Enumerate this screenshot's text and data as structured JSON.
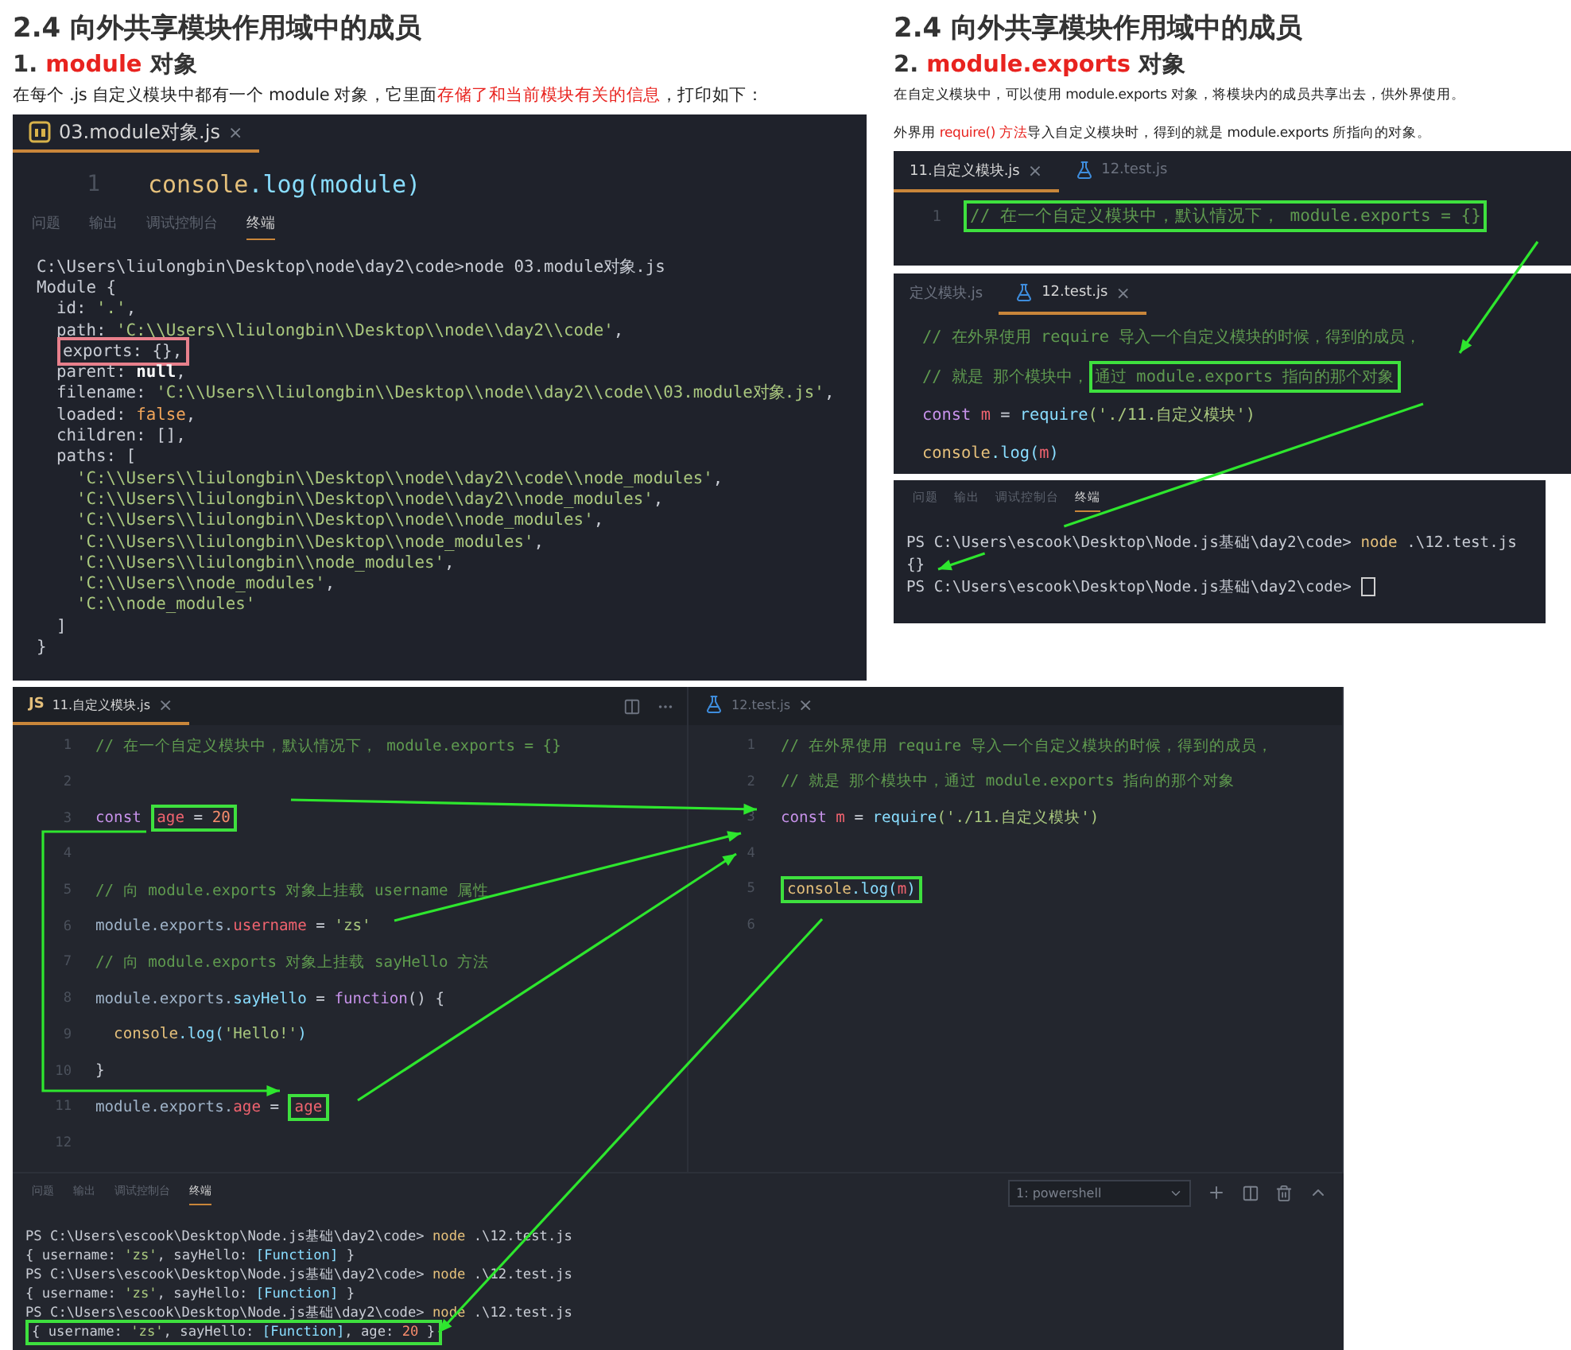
{
  "left_slide": {
    "title": "2.4 向外共享模块作用域中的成员",
    "heading": {
      "number": "1.",
      "keyword": "module",
      "suffix": "对象"
    },
    "description": [
      {
        "text": "在每个 .js 自定义模块中都有一个 module 对象，它里面",
        "emphasis": false
      },
      {
        "text": "存储了和当前模块有关的信息",
        "emphasis": true
      },
      {
        "text": "，打印如下：",
        "emphasis": false
      }
    ],
    "editor": {
      "tabs": [
        {
          "label": "03.module对象.js",
          "kind": "script",
          "close": "×",
          "selected": true
        }
      ],
      "lines": [
        {
          "number": "1",
          "tokens": [
            {
              "kind": "function",
              "text": "console"
            },
            {
              "kind": "method",
              "text": ".log(module)"
            }
          ]
        }
      ]
    },
    "panel_tabs": [
      {
        "label": "问题",
        "selected": false
      },
      {
        "label": "输出",
        "selected": false
      },
      {
        "label": "调试控制台",
        "selected": false
      },
      {
        "label": "终端",
        "selected": true
      }
    ],
    "terminal": [
      {
        "tokens": [
          {
            "kind": "text",
            "text": "C:\\Users\\liulongbin\\Desktop\\node\\day2\\code>node 03.module对象.js"
          }
        ]
      },
      {
        "tokens": [
          {
            "kind": "text",
            "text": "Module {"
          }
        ]
      },
      {
        "tokens": [
          {
            "kind": "text",
            "text": "  id: "
          },
          {
            "kind": "string",
            "text": "'.'"
          },
          {
            "kind": "text",
            "text": ","
          }
        ]
      },
      {
        "tokens": [
          {
            "kind": "text",
            "text": "  path: "
          },
          {
            "kind": "string",
            "text": "'C:\\\\Users\\\\liulongbin\\\\Desktop\\\\node\\\\day2\\\\code'"
          },
          {
            "kind": "text",
            "text": ","
          }
        ]
      },
      {
        "tokens": [
          {
            "kind": "frame",
            "tokens": [
              {
                "kind": "text",
                "text": "exports: {},"
              }
            ]
          }
        ]
      },
      {
        "tokens": [
          {
            "kind": "text",
            "text": "  parent: "
          },
          {
            "kind": "null",
            "text": "null"
          },
          {
            "kind": "text",
            "text": ","
          }
        ]
      },
      {
        "tokens": [
          {
            "kind": "text",
            "text": "  filename: "
          },
          {
            "kind": "string",
            "text": "'C:\\\\Users\\\\liulongbin\\\\Desktop\\\\node\\\\day2\\\\code\\\\03.module对象.js'"
          },
          {
            "kind": "text",
            "text": ","
          }
        ]
      },
      {
        "tokens": [
          {
            "kind": "text",
            "text": "  loaded: "
          },
          {
            "kind": "boolean",
            "text": "false"
          },
          {
            "kind": "text",
            "text": ","
          }
        ]
      },
      {
        "tokens": [
          {
            "kind": "text",
            "text": "  children: [],"
          }
        ]
      },
      {
        "tokens": [
          {
            "kind": "text",
            "text": "  paths: ["
          }
        ]
      },
      {
        "tokens": [
          {
            "kind": "string",
            "text": "    'C:\\\\Users\\\\liulongbin\\\\Desktop\\\\node\\\\day2\\\\code\\\\node_modules'"
          },
          {
            "kind": "text",
            "text": ","
          }
        ]
      },
      {
        "tokens": [
          {
            "kind": "string",
            "text": "    'C:\\\\Users\\\\liulongbin\\\\Desktop\\\\node\\\\day2\\\\node_modules'"
          },
          {
            "kind": "text",
            "text": ","
          }
        ]
      },
      {
        "tokens": [
          {
            "kind": "string",
            "text": "    'C:\\\\Users\\\\liulongbin\\\\Desktop\\\\node\\\\node_modules'"
          },
          {
            "kind": "text",
            "text": ","
          }
        ]
      },
      {
        "tokens": [
          {
            "kind": "string",
            "text": "    'C:\\\\Users\\\\liulongbin\\\\Desktop\\\\node_modules'"
          },
          {
            "kind": "text",
            "text": ","
          }
        ]
      },
      {
        "tokens": [
          {
            "kind": "string",
            "text": "    'C:\\\\Users\\\\liulongbin\\\\node_modules'"
          },
          {
            "kind": "text",
            "text": ","
          }
        ]
      },
      {
        "tokens": [
          {
            "kind": "string",
            "text": "    'C:\\\\Users\\\\node_modules'"
          },
          {
            "kind": "text",
            "text": ","
          }
        ]
      },
      {
        "tokens": [
          {
            "kind": "string",
            "text": "    'C:\\\\node_modules'"
          }
        ]
      },
      {
        "tokens": [
          {
            "kind": "text",
            "text": "  ]"
          }
        ]
      },
      {
        "tokens": [
          {
            "kind": "text",
            "text": "}"
          }
        ]
      }
    ]
  },
  "right_slide": {
    "title": "2.4 向外共享模块作用域中的成员",
    "heading": {
      "number": "2.",
      "keyword": "module.exports",
      "suffix": "对象"
    },
    "description": [
      {
        "text": "在自定义模块中，可以使用 module.exports 对象，将模块内的成员共享出去，供外界使用。",
        "emphasis": false
      }
    ],
    "note": [
      {
        "text": "外界用 ",
        "emphasis": false
      },
      {
        "text": "require() 方法",
        "emphasis": true
      },
      {
        "text": "导入自定义模块时，得到的就是 module.exports 所指向的对象。",
        "emphasis": false
      }
    ],
    "module_editor": {
      "tabs": [
        {
          "label": "11.自定义模块.js",
          "close": "×",
          "selected": true
        },
        {
          "label": "12.test.js",
          "kind": "test",
          "selected": false
        }
      ],
      "lines": [
        {
          "number": "1",
          "tokens": [
            {
              "kind": "box",
              "tokens": [
                {
                  "kind": "comment",
                  "text": "// 在一个自定义模块中，默认情况下， module.exports = {}"
                }
              ]
            }
          ]
        }
      ]
    },
    "test_editor": {
      "tabs": [
        {
          "label": "定义模块.js",
          "selected": false
        },
        {
          "label": "12.test.js",
          "kind": "test",
          "close": "×",
          "selected": true
        }
      ],
      "lines": [
        {
          "tokens": [
            {
              "kind": "comment",
              "text": "// 在外界使用 require 导入一个自定义模块的时候，得到的成员，"
            }
          ]
        },
        {
          "tokens": [
            {
              "kind": "comment",
              "text": "// 就是 那个模块中，"
            },
            {
              "kind": "box",
              "tokens": [
                {
                  "kind": "comment",
                  "text": "通过 module.exports 指向的那个对象"
                }
              ]
            }
          ]
        },
        {
          "tokens": [
            {
              "kind": "keyword",
              "text": "const "
            },
            {
              "kind": "variable",
              "text": "m"
            },
            {
              "kind": "text",
              "text": " = "
            },
            {
              "kind": "method",
              "text": "require"
            },
            {
              "kind": "string",
              "text": "('./11.自定义模块')"
            }
          ]
        },
        {
          "tokens": [
            {
              "kind": "function",
              "text": "console"
            },
            {
              "kind": "method",
              "text": ".log("
            },
            {
              "kind": "variable",
              "text": "m"
            },
            {
              "kind": "method",
              "text": ")"
            }
          ]
        }
      ]
    },
    "panel_tabs": [
      {
        "label": "问题",
        "selected": false
      },
      {
        "label": "输出",
        "selected": false
      },
      {
        "label": "调试控制台",
        "selected": false
      },
      {
        "label": "终端",
        "selected": true
      }
    ],
    "terminal": [
      {
        "cursor": false,
        "tokens": [
          {
            "kind": "text",
            "text": "PS C:\\Users\\escook\\Desktop\\Node.js基础\\day2\\code> "
          },
          {
            "kind": "command",
            "text": "node"
          },
          {
            "kind": "text",
            "text": " .\\12.test.js"
          }
        ]
      },
      {
        "cursor": false,
        "tokens": [
          {
            "kind": "text",
            "text": "{}"
          }
        ]
      },
      {
        "cursor": true,
        "tokens": [
          {
            "kind": "text",
            "text": "PS C:\\Users\\escook\\Desktop\\Node.js基础\\day2\\code> "
          }
        ]
      }
    ]
  },
  "workspace": {
    "left_pane": {
      "tabs": [
        {
          "label": "11.自定义模块.js",
          "badge": "JS",
          "close": "×",
          "selected": true
        }
      ],
      "lines": [
        {
          "number": "1",
          "tokens": [
            {
              "kind": "comment",
              "text": "// 在一个自定义模块中，默认情况下， module.exports = {}"
            }
          ]
        },
        {
          "number": "2"
        },
        {
          "number": "3",
          "tokens": [
            {
              "kind": "keyword",
              "text": "const "
            },
            {
              "kind": "box",
              "tokens": [
                {
                  "kind": "variable",
                  "text": "age"
                },
                {
                  "kind": "text",
                  "text": " = "
                },
                {
                  "kind": "number",
                  "text": "20"
                }
              ]
            }
          ]
        },
        {
          "number": "4"
        },
        {
          "number": "5",
          "tokens": [
            {
              "kind": "comment",
              "text": "// 向 module.exports 对象上挂载 username 属性"
            }
          ]
        },
        {
          "number": "6",
          "tokens": [
            {
              "kind": "property",
              "text": "module.exports."
            },
            {
              "kind": "variable",
              "text": "username"
            },
            {
              "kind": "text",
              "text": " = "
            },
            {
              "kind": "string",
              "text": "'zs'"
            }
          ]
        },
        {
          "number": "7",
          "tokens": [
            {
              "kind": "comment",
              "text": "// 向 module.exports 对象上挂载 sayHello 方法"
            }
          ]
        },
        {
          "number": "8",
          "tokens": [
            {
              "kind": "property",
              "text": "module.exports."
            },
            {
              "kind": "method",
              "text": "sayHello"
            },
            {
              "kind": "text",
              "text": " = "
            },
            {
              "kind": "keyword",
              "text": "function"
            },
            {
              "kind": "text",
              "text": "() {"
            }
          ]
        },
        {
          "number": "9",
          "tokens": [
            {
              "kind": "function",
              "text": "  console"
            },
            {
              "kind": "method",
              "text": ".log("
            },
            {
              "kind": "string",
              "text": "'Hello!'"
            },
            {
              "kind": "method",
              "text": ")"
            }
          ]
        },
        {
          "number": "10",
          "tokens": [
            {
              "kind": "text",
              "text": "}"
            }
          ]
        },
        {
          "number": "11",
          "tokens": [
            {
              "kind": "property",
              "text": "module.exports."
            },
            {
              "kind": "variable",
              "text": "age"
            },
            {
              "kind": "text",
              "text": " = "
            },
            {
              "kind": "box",
              "tokens": [
                {
                  "kind": "variable",
                  "text": "age"
                }
              ]
            }
          ]
        },
        {
          "number": "12"
        }
      ]
    },
    "right_pane": {
      "tabs": [
        {
          "label": "12.test.js",
          "kind": "test",
          "close": "×",
          "selected": false
        }
      ],
      "lines": [
        {
          "number": "1",
          "tokens": [
            {
              "kind": "comment",
              "text": "// 在外界使用 require 导入一个自定义模块的时候，得到的成员，"
            }
          ]
        },
        {
          "number": "2",
          "tokens": [
            {
              "kind": "comment",
              "text": "// 就是 那个模块中，通过 module.exports 指向的那个对象"
            }
          ]
        },
        {
          "number": "3",
          "tokens": [
            {
              "kind": "keyword",
              "text": "const "
            },
            {
              "kind": "variable",
              "text": "m"
            },
            {
              "kind": "text",
              "text": " = "
            },
            {
              "kind": "method",
              "text": "require"
            },
            {
              "kind": "string",
              "text": "('./11.自定义模块')"
            }
          ]
        },
        {
          "number": "4"
        },
        {
          "number": "5",
          "tokens": [
            {
              "kind": "box",
              "tokens": [
                {
                  "kind": "function",
                  "text": "console"
                },
                {
                  "kind": "method",
                  "text": ".log("
                },
                {
                  "kind": "variable",
                  "text": "m"
                },
                {
                  "kind": "method",
                  "text": ")"
                }
              ]
            }
          ]
        },
        {
          "number": "6"
        }
      ]
    },
    "panel_tabs": [
      {
        "label": "问题",
        "selected": false
      },
      {
        "label": "输出",
        "selected": false
      },
      {
        "label": "调试控制台",
        "selected": false
      },
      {
        "label": "终端",
        "selected": true
      }
    ],
    "shell": "1: powershell",
    "terminal": [
      {
        "tokens": [
          {
            "kind": "text",
            "text": "PS C:\\Users\\escook\\Desktop\\Node.js基础\\day2\\code> "
          },
          {
            "kind": "command",
            "text": "node"
          },
          {
            "kind": "text",
            "text": " .\\12.test.js"
          }
        ]
      },
      {
        "tokens": [
          {
            "kind": "text",
            "text": "{ username: "
          },
          {
            "kind": "string",
            "text": "'zs'"
          },
          {
            "kind": "text",
            "text": ", sayHello: "
          },
          {
            "kind": "method",
            "text": "[Function]"
          },
          {
            "kind": "text",
            "text": " }"
          }
        ]
      },
      {
        "tokens": [
          {
            "kind": "text",
            "text": "PS C:\\Users\\escook\\Desktop\\Node.js基础\\day2\\code> "
          },
          {
            "kind": "command",
            "text": "node"
          },
          {
            "kind": "text",
            "text": " .\\12.test.js"
          }
        ]
      },
      {
        "tokens": [
          {
            "kind": "text",
            "text": "{ username: "
          },
          {
            "kind": "string",
            "text": "'zs'"
          },
          {
            "kind": "text",
            "text": ", sayHello: "
          },
          {
            "kind": "method",
            "text": "[Function]"
          },
          {
            "kind": "text",
            "text": " }"
          }
        ]
      },
      {
        "tokens": [
          {
            "kind": "text",
            "text": "PS C:\\Users\\escook\\Desktop\\Node.js基础\\day2\\code> "
          },
          {
            "kind": "command",
            "text": "node"
          },
          {
            "kind": "text",
            "text": " .\\12.test.js"
          }
        ]
      },
      {
        "tokens": [
          {
            "kind": "box",
            "tokens": [
              {
                "kind": "text",
                "text": "{ username: "
              },
              {
                "kind": "string",
                "text": "'zs'"
              },
              {
                "kind": "text",
                "text": ", sayHello: "
              },
              {
                "kind": "method",
                "text": "[Function]"
              },
              {
                "kind": "text",
                "text": ", age: "
              },
              {
                "kind": "number",
                "text": "20"
              },
              {
                "kind": "text",
                "text": " }"
              }
            ]
          }
        ]
      }
    ]
  }
}
